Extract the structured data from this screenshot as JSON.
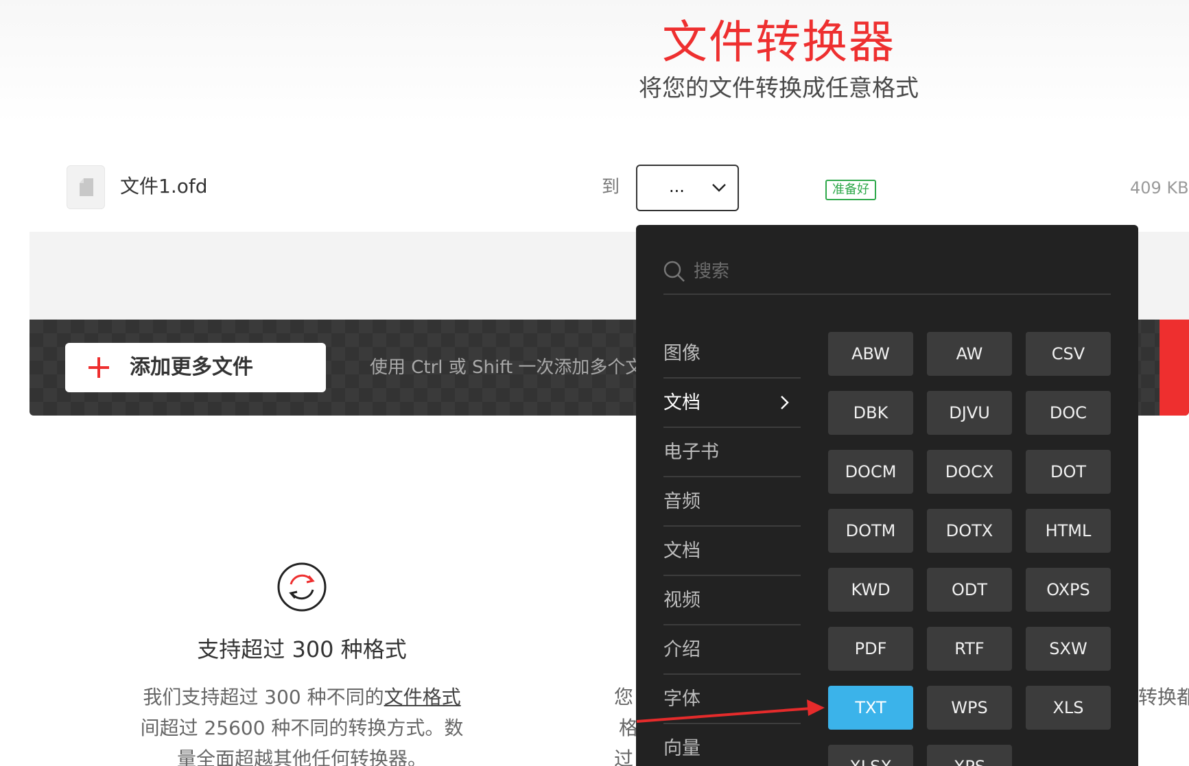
{
  "header": {
    "title": "文件转换器",
    "subtitle": "将您的文件转换成任意格式"
  },
  "file": {
    "name": "文件1.ofd",
    "to_label": "到",
    "selected_format": "...",
    "status": "准备好",
    "size": "409 KB"
  },
  "toolbar": {
    "add_label": "添加更多文件",
    "hint": "使用 Ctrl 或 Shift 一次添加多个文件"
  },
  "dropdown": {
    "search_placeholder": "搜索",
    "categories": [
      "图像",
      "文档",
      "电子书",
      "音频",
      "文档",
      "视频",
      "介绍",
      "字体",
      "向量"
    ],
    "active_category": "文档",
    "formats": [
      "ABW",
      "AW",
      "CSV",
      "DBK",
      "DJVU",
      "DOC",
      "DOCM",
      "DOCX",
      "DOT",
      "DOTM",
      "DOTX",
      "HTML",
      "KWD",
      "ODT",
      "OXPS",
      "PDF",
      "RTF",
      "SXW",
      "TXT",
      "WPS",
      "XLS",
      "XLSX",
      "XPS"
    ],
    "highlighted_format": "TXT"
  },
  "feature": {
    "title": "支持超过 300 种格式",
    "line1_prefix": "我们支持超过 300 种不同的",
    "line1_link": "文件格式",
    "line2": "间超过 25600 种不同的转换方式。数",
    "line3": "量全面超越其他任何转换器。"
  },
  "side_fragments": {
    "middle_col": [
      "您",
      "格",
      "过"
    ],
    "right_col": "转换都"
  },
  "colors": {
    "brand_red": "#ee2f2f",
    "ready_green": "#2ea84a",
    "highlight_blue": "#3bb3ea",
    "panel_bg": "#222222"
  }
}
